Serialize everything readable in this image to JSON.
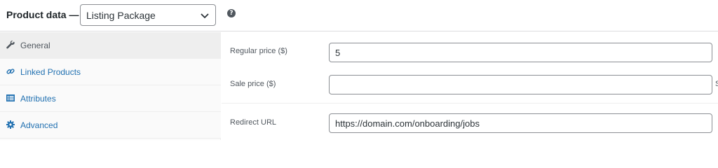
{
  "header": {
    "title": "Product data —",
    "product_type": {
      "selected": "Listing Package",
      "icon": "chevron-down-icon"
    },
    "help_icon": "?"
  },
  "sidebar": {
    "tabs": [
      {
        "label": "General",
        "icon": "wrench-icon",
        "active": true
      },
      {
        "label": "Linked Products",
        "icon": "link-icon",
        "active": false
      },
      {
        "label": "Attributes",
        "icon": "list-icon",
        "active": false
      },
      {
        "label": "Advanced",
        "icon": "gear-icon",
        "active": false
      }
    ]
  },
  "panel": {
    "regular_price": {
      "label": "Regular price ($)",
      "value": "5"
    },
    "sale_price": {
      "label": "Sale price ($)",
      "value": ""
    },
    "schedule_link_partial": "S",
    "redirect_url": {
      "label": "Redirect URL",
      "value": "https://domain.com/onboarding/jobs"
    }
  },
  "colors": {
    "link": "#2271b1",
    "active_tab_bg": "#eeeeee",
    "sidebar_bg": "#fafafa",
    "border": "#8c8f94"
  }
}
